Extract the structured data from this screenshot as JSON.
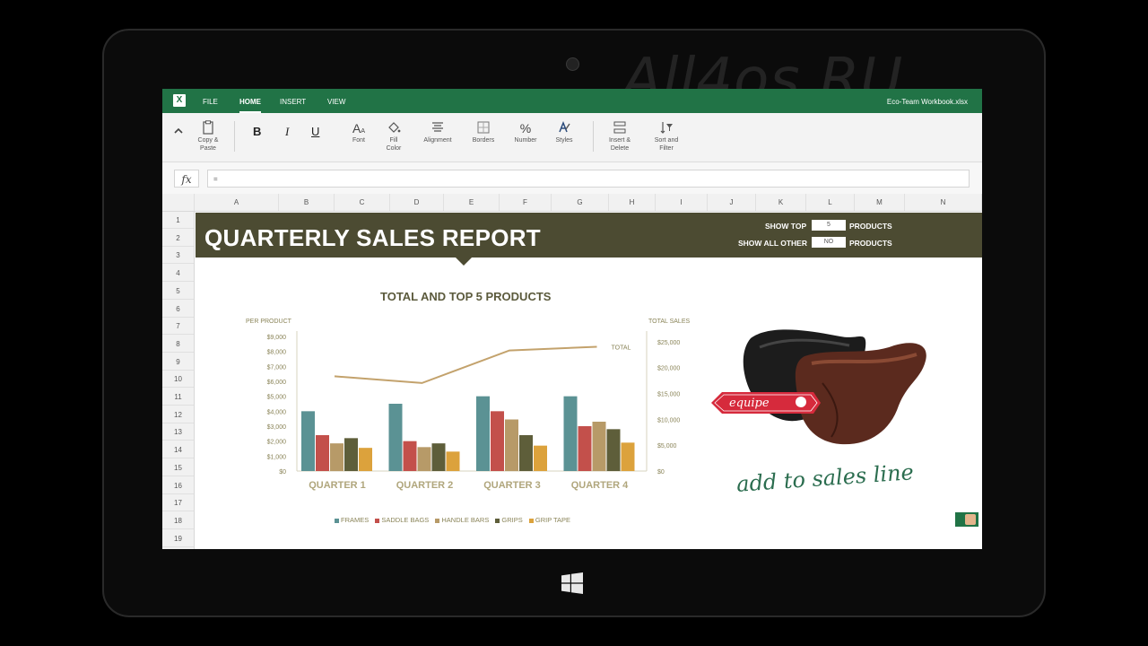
{
  "watermark": "All4os.RU",
  "app": {
    "icon_letter": "X",
    "menu": [
      {
        "label": "FILE"
      },
      {
        "label": "HOME"
      },
      {
        "label": "INSERT"
      },
      {
        "label": "VIEW"
      }
    ],
    "workbook_name": "Eco-Team Workbook.xlsx",
    "accent_color": "#217346"
  },
  "ribbon": {
    "collapse_icon": "chevron-up-icon",
    "copy_paste": "Copy &\nPaste",
    "bold": "B",
    "italic": "I",
    "underline": "U",
    "font": "Font",
    "fill_color": "Fill\nColor",
    "alignment": "Alignment",
    "borders": "Borders",
    "number": "Number",
    "number_glyph": "%",
    "styles": "Styles",
    "insert_delete": "Insert &\nDelete",
    "sort_filter": "Sort and\nFilter"
  },
  "formula_bar": {
    "fx": "fx",
    "value": "="
  },
  "columns": [
    "A",
    "B",
    "C",
    "D",
    "E",
    "F",
    "G",
    "H",
    "I",
    "J",
    "K",
    "L",
    "M",
    "N"
  ],
  "rows": [
    "1",
    "2",
    "3",
    "4",
    "5",
    "6",
    "7",
    "8",
    "9",
    "10",
    "11",
    "12",
    "13",
    "14",
    "15",
    "16",
    "17",
    "18",
    "19"
  ],
  "report": {
    "title": "QUARTERLY SALES REPORT",
    "show_top_label": "SHOW TOP",
    "show_top_value": "5",
    "products_label_1": "PRODUCTS",
    "show_all_label": "SHOW ALL OTHER",
    "show_all_value": "NO",
    "products_label_2": "PRODUCTS",
    "banner_color": "#4c4b32"
  },
  "promo": {
    "brand": "equipe",
    "caption": "add to sales line"
  },
  "chart_data": {
    "type": "bar",
    "title": "TOTAL AND TOP 5 PRODUCTS",
    "ylabel": "PER PRODUCT",
    "y2label": "TOTAL SALES",
    "categories": [
      "QUARTER 1",
      "QUARTER 2",
      "QUARTER 3",
      "QUARTER 4"
    ],
    "ylim": [
      0,
      9000
    ],
    "y2lim": [
      0,
      26000
    ],
    "yticks": [
      "$0",
      "$1,000",
      "$2,000",
      "$3,000",
      "$4,000",
      "$5,000",
      "$6,000",
      "$7,000",
      "$8,000",
      "$9,000"
    ],
    "y2ticks": [
      "$0",
      "$5,000",
      "$10,000",
      "$15,000",
      "$20,000",
      "$25,000"
    ],
    "series": [
      {
        "name": "FRAMES",
        "color": "#5b9294",
        "values": [
          4000,
          4500,
          5000,
          5000
        ]
      },
      {
        "name": "SADDLE BAGS",
        "color": "#c3504b",
        "values": [
          2400,
          2000,
          4000,
          3000
        ]
      },
      {
        "name": "HANDLE BARS",
        "color": "#b79a68",
        "values": [
          1850,
          1600,
          3450,
          3300
        ]
      },
      {
        "name": "GRIPS",
        "color": "#5e5e3a",
        "values": [
          2200,
          1850,
          2400,
          2800
        ]
      },
      {
        "name": "GRIP TAPE",
        "color": "#dca23c",
        "values": [
          1550,
          1300,
          1700,
          1900
        ]
      }
    ],
    "line": {
      "name": "TOTAL",
      "color": "#c3a26c",
      "values": [
        18300,
        17000,
        23300,
        24000
      ]
    },
    "grid": false,
    "legend": "bottom"
  }
}
